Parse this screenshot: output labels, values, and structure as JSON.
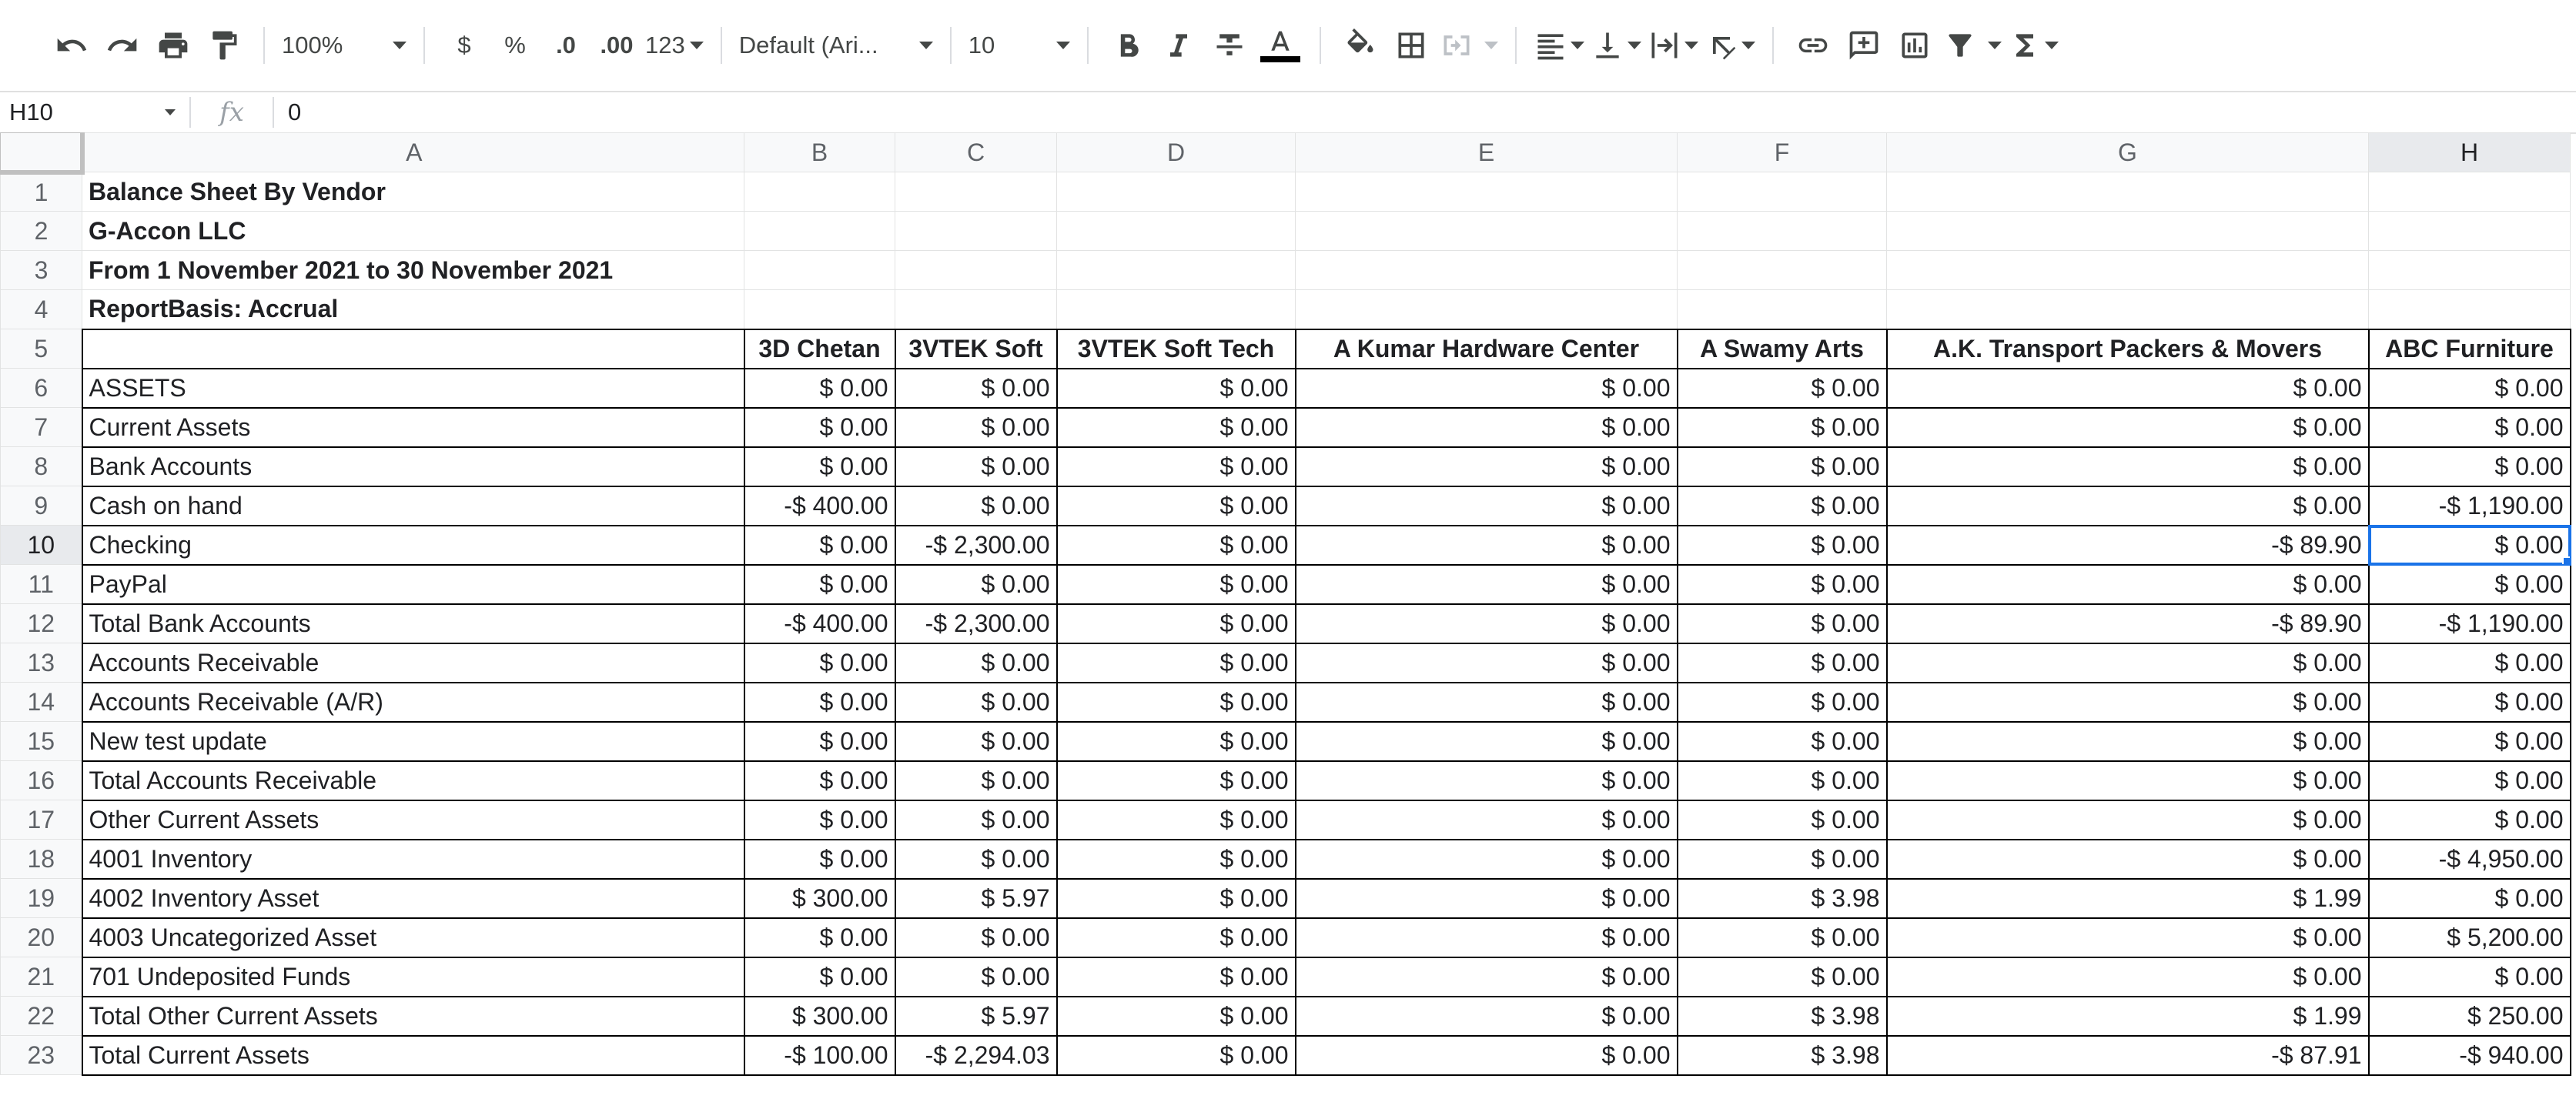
{
  "toolbar": {
    "zoom": "100%",
    "currency_symbol": "$",
    "percent_symbol": "%",
    "decrease_decimal": ".0",
    "increase_decimal": ".00",
    "number_format": "123",
    "font_family": "Default (Ari...",
    "font_size": "10",
    "icons": [
      "undo-icon",
      "redo-icon",
      "print-icon",
      "paint-format-icon",
      "bold-icon",
      "italic-icon",
      "strikethrough-icon",
      "text-color-icon",
      "fill-color-icon",
      "borders-icon",
      "merge-cells-icon",
      "horizontal-align-icon",
      "vertical-align-icon",
      "text-wrapping-icon",
      "text-rotation-icon",
      "insert-link-icon",
      "insert-comment-icon",
      "insert-chart-icon",
      "filter-icon",
      "functions-icon"
    ],
    "text_color_bar": "#000000"
  },
  "formula_bar": {
    "cell_ref": "H10",
    "fx_label": "fx",
    "value": "0"
  },
  "selected_cell": "H10",
  "accent_color": "#1a73e8",
  "columns": [
    "A",
    "B",
    "C",
    "D",
    "E",
    "F",
    "G",
    "H"
  ],
  "rows": [
    {
      "n": "1",
      "cells": [
        "Balance Sheet By Vendor",
        "",
        "",
        "",
        "",
        "",
        "",
        ""
      ]
    },
    {
      "n": "2",
      "cells": [
        "G-Accon LLC",
        "",
        "",
        "",
        "",
        "",
        "",
        ""
      ]
    },
    {
      "n": "3",
      "cells": [
        "From 1 November 2021 to 30 November 2021",
        "",
        "",
        "",
        "",
        "",
        "",
        ""
      ]
    },
    {
      "n": "4",
      "cells": [
        "ReportBasis: Accrual",
        "",
        "",
        "",
        "",
        "",
        "",
        ""
      ]
    },
    {
      "n": "5",
      "cells": [
        "",
        "3D Chetan",
        "3VTEK Soft",
        "3VTEK Soft Tech",
        "A Kumar Hardware Center",
        "A Swamy Arts",
        "A.K. Transport Packers & Movers",
        "ABC Furniture"
      ]
    },
    {
      "n": "6",
      "cells": [
        "ASSETS",
        "$ 0.00",
        "$ 0.00",
        "$ 0.00",
        "$ 0.00",
        "$ 0.00",
        "$ 0.00",
        "$ 0.00"
      ]
    },
    {
      "n": "7",
      "cells": [
        "Current Assets",
        "$ 0.00",
        "$ 0.00",
        "$ 0.00",
        "$ 0.00",
        "$ 0.00",
        "$ 0.00",
        "$ 0.00"
      ]
    },
    {
      "n": "8",
      "cells": [
        "Bank Accounts",
        "$ 0.00",
        "$ 0.00",
        "$ 0.00",
        "$ 0.00",
        "$ 0.00",
        "$ 0.00",
        "$ 0.00"
      ]
    },
    {
      "n": "9",
      "cells": [
        "Cash on hand",
        "-$ 400.00",
        "$ 0.00",
        "$ 0.00",
        "$ 0.00",
        "$ 0.00",
        "$ 0.00",
        "-$ 1,190.00"
      ]
    },
    {
      "n": "10",
      "cells": [
        "Checking",
        "$ 0.00",
        "-$ 2,300.00",
        "$ 0.00",
        "$ 0.00",
        "$ 0.00",
        "-$ 89.90",
        "$ 0.00"
      ]
    },
    {
      "n": "11",
      "cells": [
        "PayPal",
        "$ 0.00",
        "$ 0.00",
        "$ 0.00",
        "$ 0.00",
        "$ 0.00",
        "$ 0.00",
        "$ 0.00"
      ]
    },
    {
      "n": "12",
      "cells": [
        "Total Bank Accounts",
        "-$ 400.00",
        "-$ 2,300.00",
        "$ 0.00",
        "$ 0.00",
        "$ 0.00",
        "-$ 89.90",
        "-$ 1,190.00"
      ]
    },
    {
      "n": "13",
      "cells": [
        "Accounts Receivable",
        "$ 0.00",
        "$ 0.00",
        "$ 0.00",
        "$ 0.00",
        "$ 0.00",
        "$ 0.00",
        "$ 0.00"
      ]
    },
    {
      "n": "14",
      "cells": [
        "Accounts Receivable (A/R)",
        "$ 0.00",
        "$ 0.00",
        "$ 0.00",
        "$ 0.00",
        "$ 0.00",
        "$ 0.00",
        "$ 0.00"
      ]
    },
    {
      "n": "15",
      "cells": [
        "New test update",
        "$ 0.00",
        "$ 0.00",
        "$ 0.00",
        "$ 0.00",
        "$ 0.00",
        "$ 0.00",
        "$ 0.00"
      ]
    },
    {
      "n": "16",
      "cells": [
        "Total Accounts Receivable",
        "$ 0.00",
        "$ 0.00",
        "$ 0.00",
        "$ 0.00",
        "$ 0.00",
        "$ 0.00",
        "$ 0.00"
      ]
    },
    {
      "n": "17",
      "cells": [
        "Other Current Assets",
        "$ 0.00",
        "$ 0.00",
        "$ 0.00",
        "$ 0.00",
        "$ 0.00",
        "$ 0.00",
        "$ 0.00"
      ]
    },
    {
      "n": "18",
      "cells": [
        "4001 Inventory",
        "$ 0.00",
        "$ 0.00",
        "$ 0.00",
        "$ 0.00",
        "$ 0.00",
        "$ 0.00",
        "-$ 4,950.00"
      ]
    },
    {
      "n": "19",
      "cells": [
        "4002 Inventory Asset",
        "$ 300.00",
        "$ 5.97",
        "$ 0.00",
        "$ 0.00",
        "$ 3.98",
        "$ 1.99",
        "$ 0.00"
      ]
    },
    {
      "n": "20",
      "cells": [
        "4003 Uncategorized Asset",
        "$ 0.00",
        "$ 0.00",
        "$ 0.00",
        "$ 0.00",
        "$ 0.00",
        "$ 0.00",
        "$ 5,200.00"
      ]
    },
    {
      "n": "21",
      "cells": [
        "701 Undeposited Funds",
        "$ 0.00",
        "$ 0.00",
        "$ 0.00",
        "$ 0.00",
        "$ 0.00",
        "$ 0.00",
        "$ 0.00"
      ]
    },
    {
      "n": "22",
      "cells": [
        "Total Other Current Assets",
        "$ 300.00",
        "$ 5.97",
        "$ 0.00",
        "$ 0.00",
        "$ 3.98",
        "$ 1.99",
        "$ 250.00"
      ]
    },
    {
      "n": "23",
      "cells": [
        "Total Current Assets",
        "-$ 100.00",
        "-$ 2,294.03",
        "$ 0.00",
        "$ 0.00",
        "$ 3.98",
        "-$ 87.91",
        "-$ 940.00"
      ]
    }
  ]
}
